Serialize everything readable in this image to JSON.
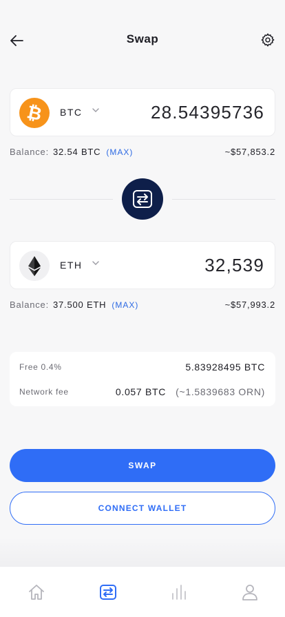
{
  "header": {
    "title": "Swap"
  },
  "from_token": {
    "symbol": "BTC",
    "amount": "28.54395736",
    "icon": "bitcoin-icon",
    "color": "#f7931a",
    "balance_label": "Balance:",
    "balance_value": "32.54 BTC",
    "max_label": "(MAX)",
    "usd_value": "~$57,853.2"
  },
  "to_token": {
    "symbol": "ETH",
    "amount": "32,539",
    "icon": "ethereum-icon",
    "color": "#3c3c3d",
    "balance_label": "Balance:",
    "balance_value": "37.500 ETH",
    "max_label": "(MAX)",
    "usd_value": "~$57,993.2"
  },
  "fees": {
    "free_label": "Free 0.4%",
    "free_value": "5.83928495 BTC",
    "network_label": "Network fee",
    "network_value": "0.057 BTC",
    "network_equiv": "(~1.5839683 ORN)"
  },
  "actions": {
    "swap_label": "SWAP",
    "connect_label": "CONNECT WALLET"
  },
  "tabbar": {
    "items": [
      {
        "icon": "home-icon",
        "active": false
      },
      {
        "icon": "swap-icon",
        "active": true
      },
      {
        "icon": "chart-icon",
        "active": false
      },
      {
        "icon": "profile-icon",
        "active": false
      }
    ]
  },
  "colors": {
    "accent": "#2f6df6",
    "swap_circle": "#0e1f4a",
    "background": "#f7f7f8"
  }
}
